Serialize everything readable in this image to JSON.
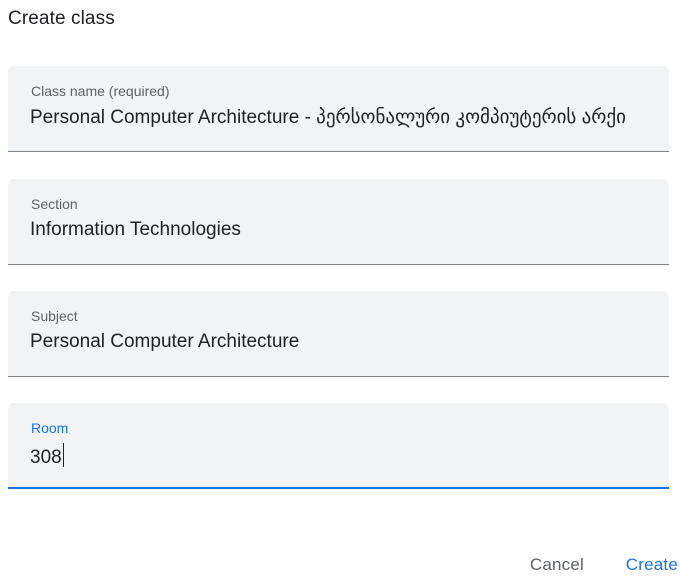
{
  "dialog": {
    "title": "Create class"
  },
  "fields": {
    "class_name": {
      "label": "Class name (required)",
      "value": "Personal Computer Architecture - პერსონალური კომპიუტერის არქი"
    },
    "section": {
      "label": "Section",
      "value": "Information Technologies"
    },
    "subject": {
      "label": "Subject",
      "value": "Personal Computer Architecture"
    },
    "room": {
      "label": "Room",
      "value": "308",
      "focused": true
    }
  },
  "actions": {
    "cancel_label": "Cancel",
    "create_label": "Create"
  },
  "colors": {
    "accent": "#1a73e8",
    "field_background": "#f1f3f4",
    "text_primary": "#202124",
    "text_secondary": "#5f6368"
  }
}
